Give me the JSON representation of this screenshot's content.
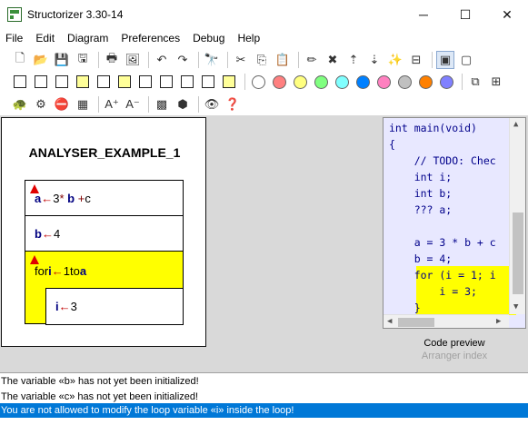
{
  "window": {
    "title": "Structorizer 3.30-14",
    "minimize_label": "─",
    "maximize_label": "☐",
    "close_label": "✕"
  },
  "menu": [
    "File",
    "Edit",
    "Diagram",
    "Preferences",
    "Debug",
    "Help"
  ],
  "toolbar_icons": {
    "row1": [
      "new-file-icon",
      "open-folder-icon",
      "save-icon",
      "save-all-icon",
      "print-icon",
      "export-picture-icon",
      "undo-icon",
      "redo-icon",
      "find-icon",
      "cut-icon",
      "copy-icon",
      "paste-icon",
      "edit-element-icon",
      "delete-element-icon",
      "move-up-icon",
      "move-down-icon",
      "transmute-icon",
      "collapse-icon",
      "unboxed-view-icon",
      "boxed-view-icon"
    ],
    "row2": [
      "add-instruction-icon",
      "add-alternative-icon",
      "add-case-icon",
      "add-for-loop-icon",
      "add-while-loop-icon",
      "add-repeat-loop-icon",
      "add-forever-loop-icon",
      "add-call-icon",
      "add-jump-icon",
      "add-parallel-icon",
      "add-try-icon"
    ],
    "colors": [
      "#ffffff",
      "#ff8080",
      "#ffff80",
      "#80ff80",
      "#80ffff",
      "#0080ff",
      "#ff80c0",
      "#c0c0c0",
      "#ff8000",
      "#8080ff"
    ],
    "row3": [
      "run-turtle-icon",
      "executor-gear-icon",
      "code-analyser-stop-icon",
      "switch-text-icon",
      "font-up-icon",
      "font-down-icon",
      "paint-3d-icon",
      "dark-box-icon",
      "hide-icon",
      "about-help-icon"
    ]
  },
  "diagram": {
    "title": "ANALYSER_EXAMPLE_1",
    "elements": [
      {
        "kind": "instruction",
        "var": "a",
        "arrow": "←",
        "rest_a": " 3 ",
        "op1": "*",
        "var2": "b",
        "op2": "+",
        "rest_b": " c"
      },
      {
        "kind": "instruction",
        "var": "b",
        "arrow": "←",
        "rest_a": " 4"
      },
      {
        "kind": "for",
        "kw_for": "for ",
        "var": "i",
        "arrow": "←",
        "rest_a": " 1 ",
        "kw_to": "to ",
        "var2": "a"
      },
      {
        "kind": "instruction",
        "var": "i",
        "arrow": "←",
        "rest_a": " 3"
      }
    ]
  },
  "code_preview": {
    "lines": [
      "int main(void)",
      "{",
      "    // TODO: Chec",
      "    int i;",
      "    int b;",
      "    ??? a;",
      "",
      "    a = 3 * b + c",
      "    b = 4;",
      "    for (i = 1; i",
      "        i = 3;",
      "    }"
    ],
    "highlighted_lines": [
      9,
      10,
      11
    ],
    "scroll_up": "▲",
    "scroll_down": "▼",
    "scroll_left": "◀",
    "scroll_right": "▶",
    "tab_active": "Code preview",
    "tab_inactive": "Arranger index"
  },
  "messages": [
    {
      "text": "The variable «b» has not yet been initialized!",
      "selected": false
    },
    {
      "text": "The variable «c» has not yet been initialized!",
      "selected": false
    },
    {
      "text": "You are not allowed to modify the loop variable «i» inside the loop!",
      "selected": true
    }
  ],
  "colors": {
    "selection": "#0078d7",
    "for_loop_fill": "#ffff00",
    "code_background": "#e8e8ff",
    "workspace": "#d9d9d9"
  }
}
